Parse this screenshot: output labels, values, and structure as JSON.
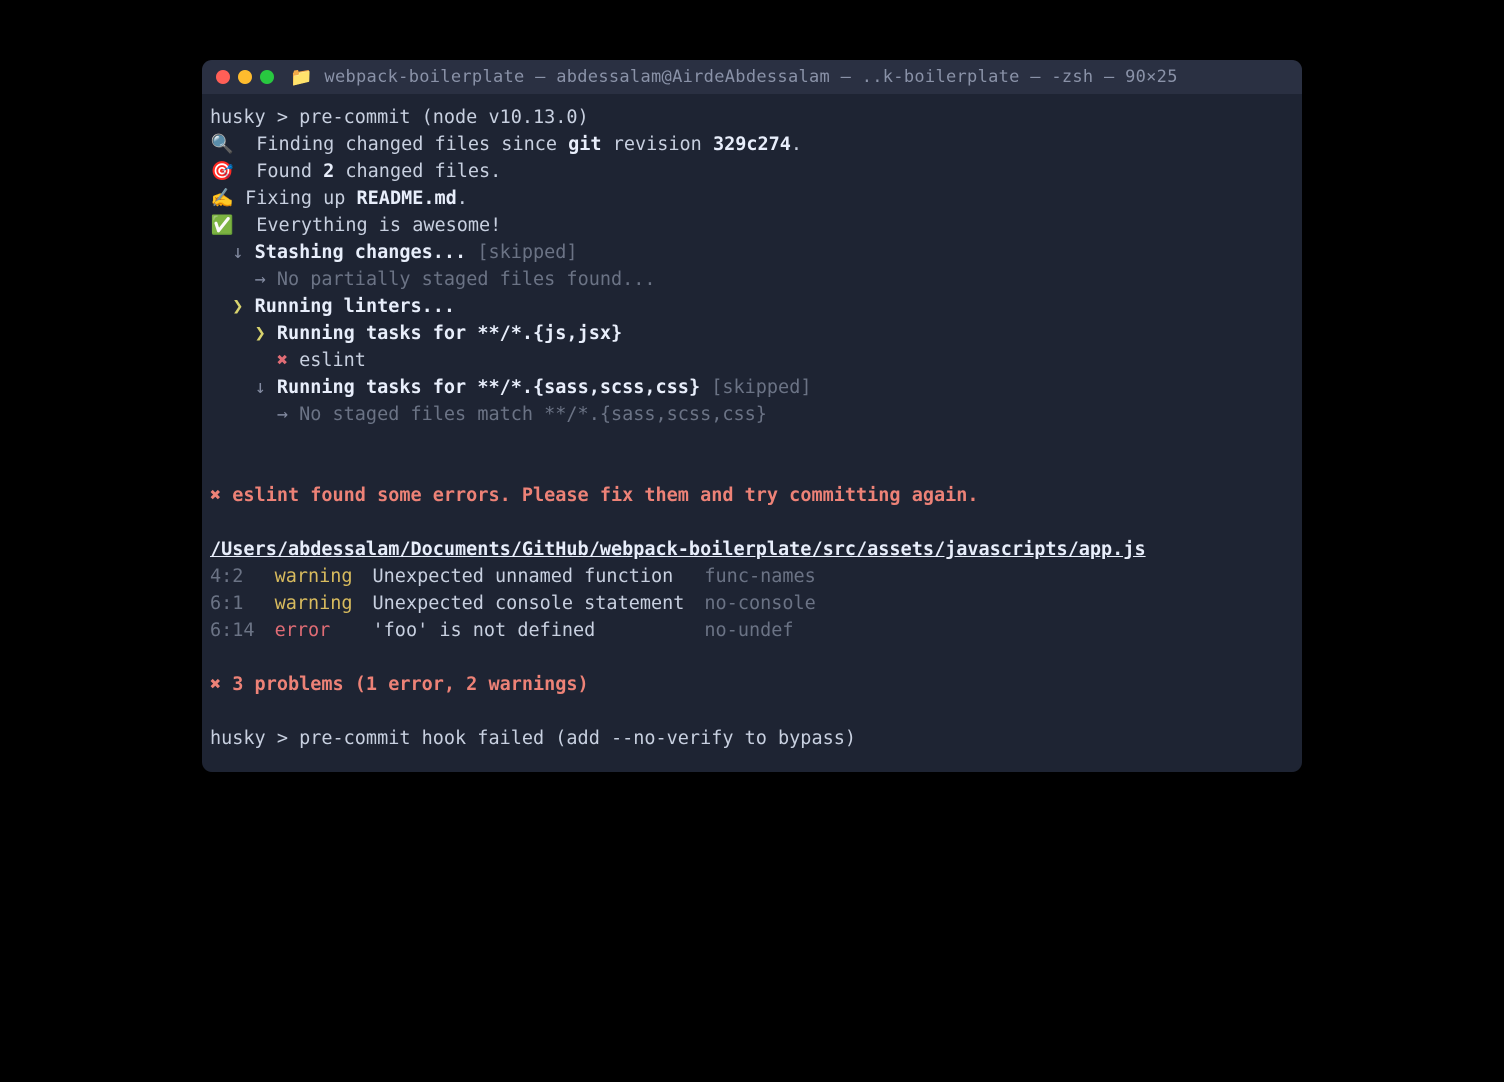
{
  "title": "webpack-boilerplate — abdessalam@AirdeAbdessalam — ..k-boilerplate — -zsh — 90×25",
  "husky_header": "husky > pre-commit (node v10.13.0)",
  "finding_prefix": "  Finding changed files since ",
  "git_word": "git",
  "revision_word": " revision ",
  "revision": "329c274",
  "found_prefix": "  Found ",
  "found_count": "2",
  "found_suffix": " changed files.",
  "fixing_prefix": " Fixing up ",
  "fixing_file": "README.md",
  "awesome": "  Everything is awesome!",
  "stashing": "Stashing changes...",
  "skipped": "[skipped]",
  "no_partial": "No partially staged files found...",
  "running_linters": "Running linters...",
  "tasks_js": "Running tasks for **/*.{js,jsx}",
  "eslint": "eslint",
  "tasks_css": "Running tasks for **/*.{sass,scss,css}",
  "no_staged_css": "No staged files match **/*.{sass,scss,css}",
  "eslint_errors": " eslint found some errors. Please fix them and try committing again.",
  "file_path": "/Users/abdessalam/Documents/GitHub/webpack-boilerplate/src/assets/javascripts/app.js",
  "problems": [
    {
      "loc": "4:2",
      "level": "warning",
      "msg": "Unexpected unnamed function",
      "rule": "func-names"
    },
    {
      "loc": "6:1",
      "level": "warning",
      "msg": "Unexpected console statement",
      "rule": "no-console"
    },
    {
      "loc": "6:14",
      "level": "error",
      "msg": "'foo' is not defined",
      "rule": "no-undef"
    }
  ],
  "summary": " 3 problems (1 error, 2 warnings)",
  "hook_failed": "husky > pre-commit hook failed (add --no-verify to bypass)",
  "icons": {
    "magnify": "🔍",
    "target": "🎯",
    "writing": "✍️",
    "check": "✅",
    "down": "↓",
    "right": "→",
    "chevron": "❯",
    "cross": "✖"
  }
}
